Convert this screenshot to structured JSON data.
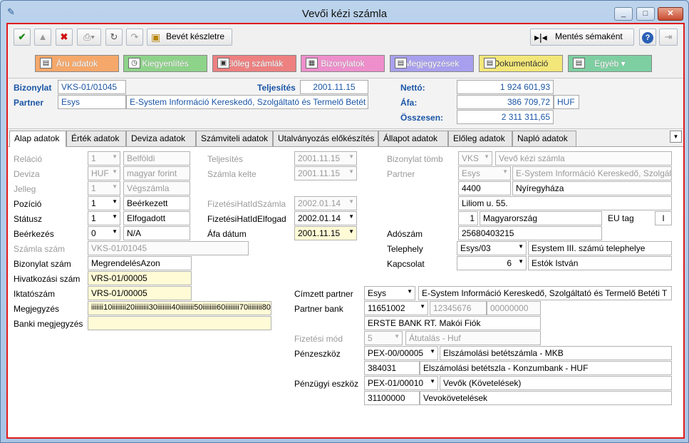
{
  "window": {
    "title": "Vevői kézi számla",
    "app_icon": "app-icon",
    "minimize": "_",
    "maximize": "□",
    "close": "✕"
  },
  "toolbar": {
    "bevet": "Bevét készletre",
    "mentes": "Mentés sémaként",
    "help": "?"
  },
  "categories": [
    {
      "label": "Áru adatok",
      "color": "#f6a86a"
    },
    {
      "label": "Kiegyenlítés",
      "color": "#8ed38a"
    },
    {
      "label": "Előleg számlák",
      "color": "#ee8080"
    },
    {
      "label": "Bizonylatok",
      "color": "#ee8fcc"
    },
    {
      "label": "Megjegyzések",
      "color": "#a8a0ee"
    },
    {
      "label": "Dokumentáció",
      "color": "#f3e77a"
    },
    {
      "label": "Egyéb",
      "color": "#7dcfa1"
    }
  ],
  "header": {
    "bizonylat_label": "Bizonylat",
    "bizonylat_value": "VKS-01/01045",
    "partner_label": "Partner",
    "partner_code": "Esys",
    "partner_name": "E-System Információ Kereskedő, Szolgáltató és Termelő Betét",
    "teljesites_label": "Teljesítés",
    "teljesites_value": "2001.11.15",
    "netto_label": "Nettó:",
    "netto_value": "1 924 601,93",
    "afa_label": "Áfa:",
    "afa_value": "386 709,72",
    "currency": "HUF",
    "osszesen_label": "Összesen:",
    "osszesen_value": "2 311 311,65"
  },
  "tabs": [
    "Alap adatok",
    "Érték adatok",
    "Deviza adatok",
    "Számviteli adatok",
    "Utalványozás előkészítés",
    "Állapot adatok",
    "Előleg adatok",
    "Napló adatok"
  ],
  "form": {
    "relacio_l": "Reláció",
    "relacio_v": "1",
    "relacio_t": "Belföldi",
    "deviza_l": "Deviza",
    "deviza_v": "HUF",
    "deviza_t": "magyar forint",
    "jelleg_l": "Jelleg",
    "jelleg_v": "1",
    "jelleg_t": "Végszámla",
    "pozicio_l": "Pozíció",
    "pozicio_v": "1",
    "pozicio_t": "Beérkezett",
    "statusz_l": "Státusz",
    "statusz_v": "1",
    "statusz_t": "Elfogadott",
    "beerkezes_l": "Beérkezés",
    "beerkezes_v": "0",
    "beerkezes_t": "N/A",
    "szamlaszam_l": "Számla szám",
    "szamlaszam_v": "VKS-01/01045",
    "bizonylatszam_l": "Bizonylat szám",
    "bizonylatszam_v": "MegrendelésAzon",
    "hivatkozasi_l": "Hivatkozási szám",
    "hivatkozasi_v": "VRS-01/00005",
    "iktato_l": "Iktatószám",
    "iktato_v": "VRS-01/00005",
    "megjegyzes_l": "Megjegyzés",
    "megjegyzes_v": "iiiiiii10iiiiiiii20iiiiiiii30iiiiiiii40iiiiiiii50iiiiiiii60iiiiiiii70iiiiiiii80",
    "banki_l": "Banki megjegyzés",
    "teljesites_l": "Teljesítés",
    "teljesites_v": "2001.11.15",
    "kelte_l": "Számla kelte",
    "kelte_v": "2001.11.15",
    "fhsz_l": "FizetésiHatIdSzámla",
    "fhsz_v": "2002.01.14",
    "fhe_l": "FizetésiHatIdElfogad",
    "fhe_v": "2002.01.14",
    "afadatum_l": "Áfa dátum",
    "afadatum_v": "2001.11.15",
    "tomb_l": "Bizonylat tömb",
    "tomb_v": "VKS",
    "tomb_t": "Vevő kézi számla",
    "partner_l": "Partner",
    "partner_v": "Esys",
    "partner_t": "E-System Információ Kereskedő, Szolgáltató",
    "irsz": "4400",
    "varos": "Nyíregyháza",
    "utca": "Liliom u. 55.",
    "orszag_kod": "1",
    "orszag": "Magyarország",
    "eutag_l": "EU tag",
    "eutag_v": "I",
    "adoszam_l": "Adószám",
    "adoszam_v": "25680403215",
    "telephely_l": "Telephely",
    "telephely_v": "Esys/03",
    "telephely_t": "Esystem III. számú telephelye",
    "kapcsolat_l": "Kapcsolat",
    "kapcsolat_v": "6",
    "kapcsolat_t": "Estók István",
    "cimzett_l": "Címzett partner",
    "cimzett_v": "Esys",
    "cimzett_t": "E-System Információ Kereskedő, Szolgáltató és Termelő Betéti T",
    "bank_l": "Partner bank",
    "bank_v": "11651002",
    "bank_2": "12345676",
    "bank_3": "00000000",
    "bank_nev": "ERSTE BANK RT. Makói Fiók",
    "fizmod_l": "Fizetési mód",
    "fizmod_v": "5",
    "fizmod_t": "Átutalás - Huf",
    "penzeszkoz_l": "Pénzeszköz",
    "penzeszkoz_v": "PEX-00/00005",
    "penzeszkoz_t": "Elszámolási betétszámla - MKB",
    "penz_kod": "384031",
    "penz_kod_t": "Elszámolási betétszla - Konzumbank - HUF",
    "penzugyi_l": "Pénzügyi eszköz",
    "penzugyi_v": "PEX-01/00010",
    "penzugyi_t": "Vevők (Követelések)",
    "penzugyi_kod": "31100000",
    "penzugyi_kod_t": "Vevokövetelések"
  }
}
